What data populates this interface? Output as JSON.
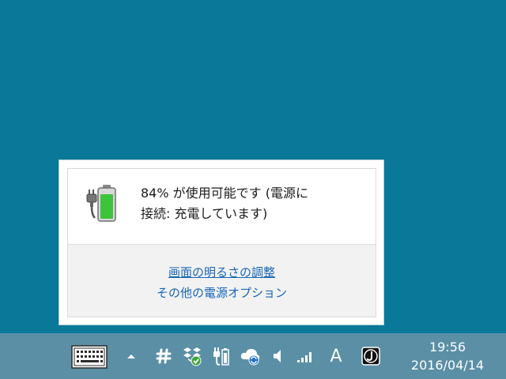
{
  "battery_flyout": {
    "status_line1": "84% が使用可能です (電源に",
    "status_line2": "接続: 充電しています)",
    "charge_level": 0.84,
    "links": {
      "brightness": "画面の明るさの調整",
      "power_options": "その他の電源オプション"
    }
  },
  "taskbar": {
    "ime_label": "A",
    "clock_time": "19:56",
    "clock_date": "2016/04/14",
    "icons": [
      "keyboard-icon",
      "chevron-up-icon",
      "hash-icon",
      "dropbox-icon",
      "power-plug-battery-icon",
      "cloud-sync-icon",
      "speaker-icon",
      "signal-icon",
      "ime-icon",
      "j-app-icon"
    ]
  },
  "colors": {
    "desktop": "#0a7898",
    "taskbar": "#5a8fa6",
    "link": "#1565b7",
    "battery_fill": "#3cc43a"
  }
}
